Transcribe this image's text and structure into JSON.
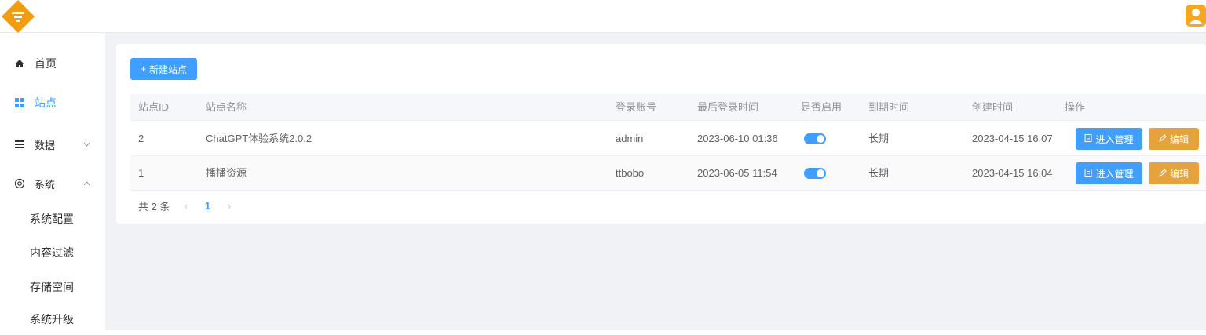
{
  "header": {
    "logo_icon": "logo-diamond-icon",
    "avatar_icon": "user-avatar-icon",
    "brand_color": "#f39c12"
  },
  "sidebar": {
    "items": [
      {
        "label": "首页",
        "icon": "home-icon"
      },
      {
        "label": "站点",
        "icon": "grid-icon"
      },
      {
        "label": "数据",
        "icon": "menu-icon",
        "arrow": "chevron-down-icon"
      },
      {
        "label": "系统",
        "icon": "gear-icon",
        "arrow": "chevron-up-icon"
      }
    ],
    "subitems": [
      "系统配置",
      "内容过滤",
      "存储空间",
      "系统升级"
    ]
  },
  "toolbar": {
    "new_site_label": "新建站点"
  },
  "table": {
    "headers": [
      "站点ID",
      "站点名称",
      "登录账号",
      "最后登录时间",
      "是否启用",
      "到期时间",
      "创建时间",
      "操作"
    ],
    "rows": [
      {
        "id": "2",
        "name": "ChatGPT体验系统2.0.2",
        "account": "admin",
        "last_login": "2023-06-10 01:36",
        "enabled": true,
        "expire": "长期",
        "created": "2023-04-15 16:07"
      },
      {
        "id": "1",
        "name": "播播资源",
        "account": "ttbobo",
        "last_login": "2023-06-05 11:54",
        "enabled": true,
        "expire": "长期",
        "created": "2023-04-15 16:04"
      }
    ],
    "manage_label": "进入管理",
    "edit_label": "编辑"
  },
  "pagination": {
    "total_label": "共 2 条",
    "current_page": "1",
    "prev": "‹",
    "next": "›"
  },
  "colors": {
    "primary": "#409eff",
    "warning": "#e6a23c",
    "background": "#f0f2f5"
  }
}
